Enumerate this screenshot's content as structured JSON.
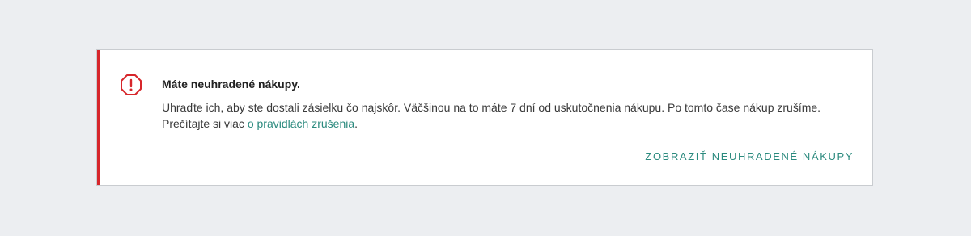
{
  "alert": {
    "icon": "alert-octagon-icon",
    "title": "Máte neuhradené nákupy.",
    "text_line1": "Uhraďte ich, aby ste dostali zásielku čo najskôr. Väčšinou na to máte 7 dní od uskutočnenia nákupu. Po tomto čase nákup zrušíme.",
    "text_line2_prefix": "Prečítajte si viac ",
    "link_label": "o pravidlách zrušenia",
    "text_line2_suffix": ".",
    "action_label": "ZOBRAZIŤ NEUHRADENÉ NÁKUPY"
  },
  "colors": {
    "page_background": "#eceef1",
    "alert_bar": "#d7262b",
    "link": "#2b8a7e"
  }
}
